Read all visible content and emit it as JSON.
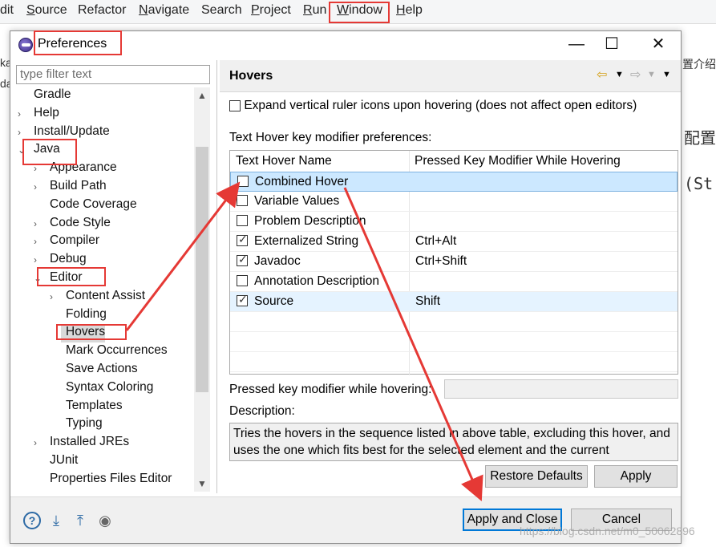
{
  "ide_menu": [
    "dit",
    "Source",
    "Refactor",
    "Navigate",
    "Search",
    "Project",
    "Run",
    "Window",
    "Help"
  ],
  "background": {
    "left_snips": [
      "ka",
      "da"
    ],
    "right_top": "置介绍",
    "right_config": "配置",
    "right_code": "(St"
  },
  "dialog": {
    "title": "Preferences",
    "minimize": "—",
    "maximize": "☐",
    "close": "✕"
  },
  "filter_placeholder": "type filter text",
  "tree": [
    {
      "label": "Gradle",
      "chev": ""
    },
    {
      "label": "Help",
      "chev": "›"
    },
    {
      "label": "Install/Update",
      "chev": "›"
    },
    {
      "label": "Java",
      "chev": "⌄"
    },
    {
      "label": "Appearance",
      "chev": "›"
    },
    {
      "label": "Build Path",
      "chev": "›"
    },
    {
      "label": "Code Coverage",
      "chev": ""
    },
    {
      "label": "Code Style",
      "chev": "›"
    },
    {
      "label": "Compiler",
      "chev": "›"
    },
    {
      "label": "Debug",
      "chev": "›"
    },
    {
      "label": "Editor",
      "chev": "⌄"
    },
    {
      "label": "Content Assist",
      "chev": "›"
    },
    {
      "label": "Folding",
      "chev": ""
    },
    {
      "label": "Hovers",
      "chev": ""
    },
    {
      "label": "Mark Occurrences",
      "chev": ""
    },
    {
      "label": "Save Actions",
      "chev": ""
    },
    {
      "label": "Syntax Coloring",
      "chev": ""
    },
    {
      "label": "Templates",
      "chev": ""
    },
    {
      "label": "Typing",
      "chev": ""
    },
    {
      "label": "Installed JREs",
      "chev": "›"
    },
    {
      "label": "JUnit",
      "chev": ""
    },
    {
      "label": "Properties Files Editor",
      "chev": ""
    }
  ],
  "page": {
    "title": "Hovers",
    "expand_label": "Expand vertical ruler icons upon hovering (does not affect open editors)",
    "section_label": "Text Hover key modifier preferences:",
    "col_name": "Text Hover Name",
    "col_mod": "Pressed Key Modifier While Hovering",
    "rows": [
      {
        "name": "Combined Hover",
        "checked": false,
        "modifier": ""
      },
      {
        "name": "Variable Values",
        "checked": false,
        "modifier": ""
      },
      {
        "name": "Problem Description",
        "checked": false,
        "modifier": ""
      },
      {
        "name": "Externalized String",
        "checked": true,
        "modifier": "Ctrl+Alt"
      },
      {
        "name": "Javadoc",
        "checked": true,
        "modifier": "Ctrl+Shift"
      },
      {
        "name": "Annotation Description",
        "checked": false,
        "modifier": ""
      },
      {
        "name": "Source",
        "checked": true,
        "modifier": "Shift"
      }
    ],
    "modifier_label": "Pressed key modifier while hovering:",
    "description_label": "Description:",
    "description_text": "Tries the hovers in the sequence listed in above table, excluding this hover, and uses the one which fits best for the selected element and the current",
    "restore_defaults": "Restore Defaults",
    "apply": "Apply"
  },
  "footer": {
    "apply_close": "Apply and Close",
    "cancel": "Cancel"
  },
  "watermark": "https://blog.csdn.net/m0_50062896",
  "colors": {
    "annotation_red": "#e53935",
    "selection": "#cce8ff"
  }
}
